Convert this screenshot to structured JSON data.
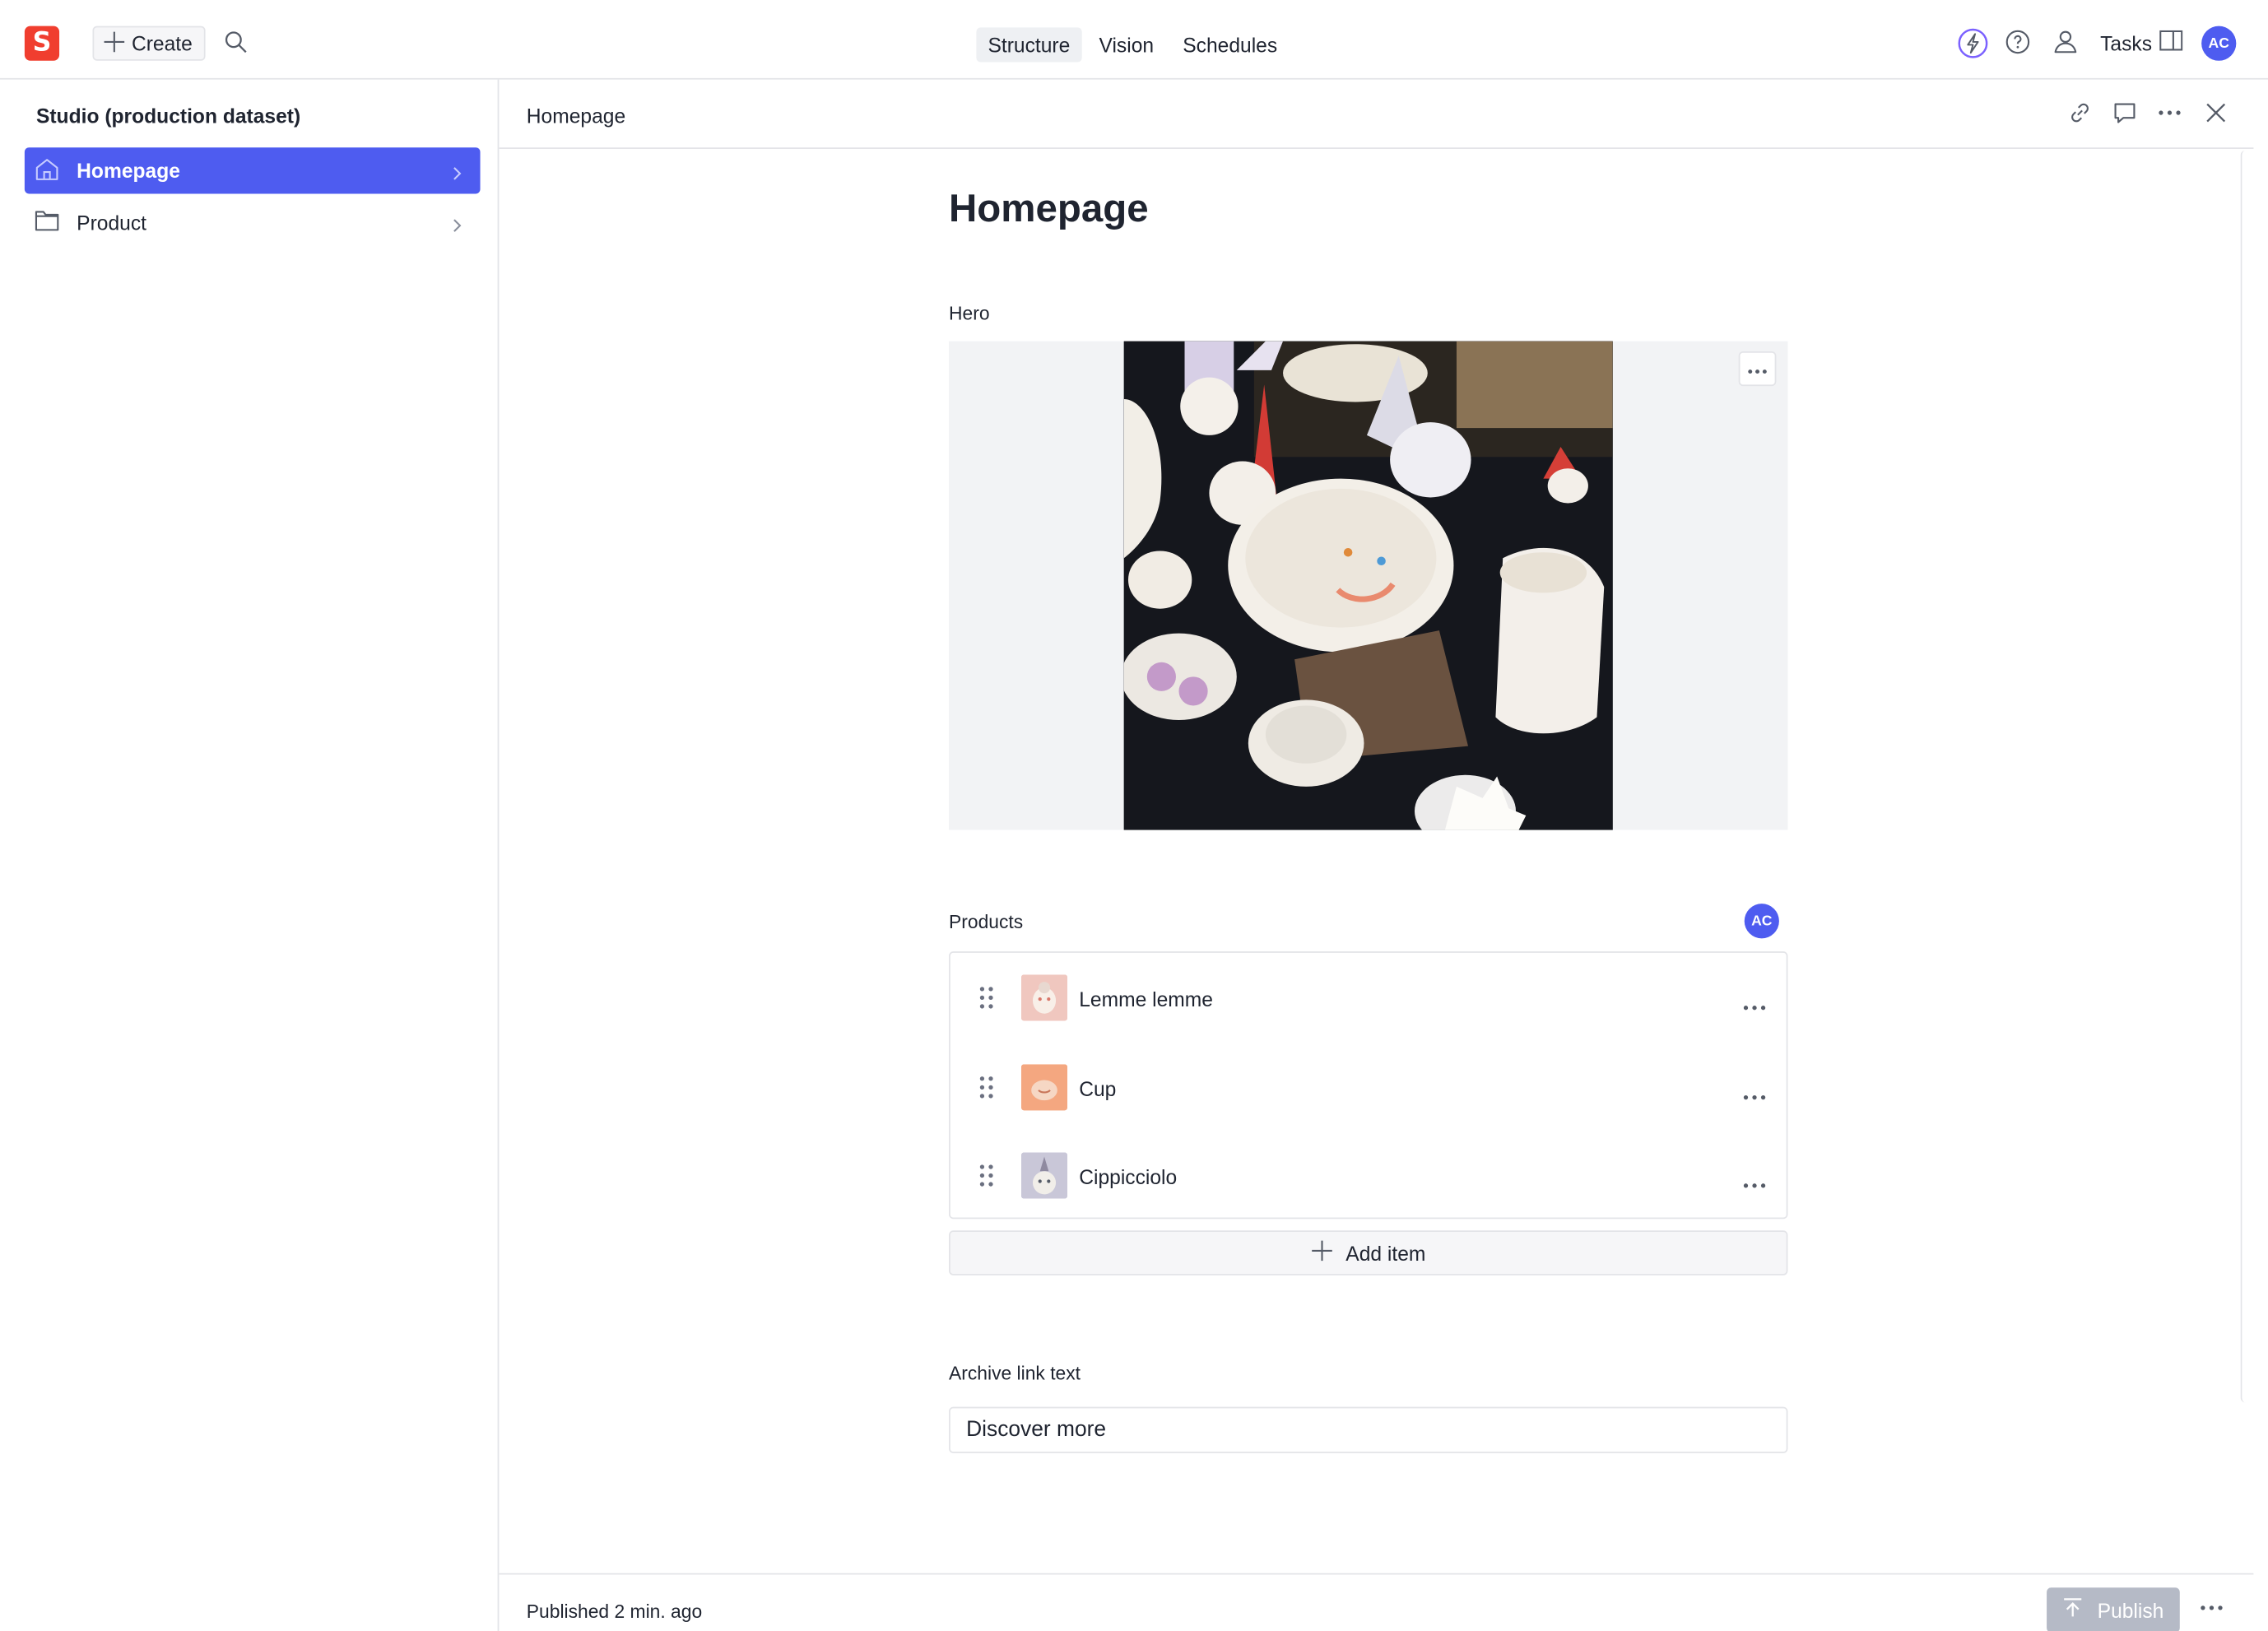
{
  "app": {
    "logo_letter": "S",
    "create_label": "Create",
    "nav_tabs": [
      "Structure",
      "Vision",
      "Schedules"
    ],
    "active_tab": "Structure",
    "tasks_label": "Tasks",
    "user_initials": "AC",
    "accent_color": "#4e5cf0",
    "brand_color": "#f03e2f"
  },
  "sidebar": {
    "title": "Studio (production dataset)",
    "items": [
      {
        "label": "Homepage",
        "icon": "home-icon",
        "selected": true
      },
      {
        "label": "Product",
        "icon": "folder-icon",
        "selected": false
      }
    ]
  },
  "document": {
    "header_title": "Homepage",
    "title": "Homepage",
    "fields": {
      "hero_label": "Hero",
      "products_label": "Products",
      "products_presence": "AC",
      "archive_label": "Archive link text"
    },
    "products": [
      {
        "name": "Lemme lemme"
      },
      {
        "name": "Cup"
      },
      {
        "name": "Cippicciolo"
      }
    ],
    "add_item_label": "Add item",
    "archive_link_value": "Discover more"
  },
  "footer": {
    "status": "Published 2 min. ago",
    "publish_label": "Publish"
  }
}
